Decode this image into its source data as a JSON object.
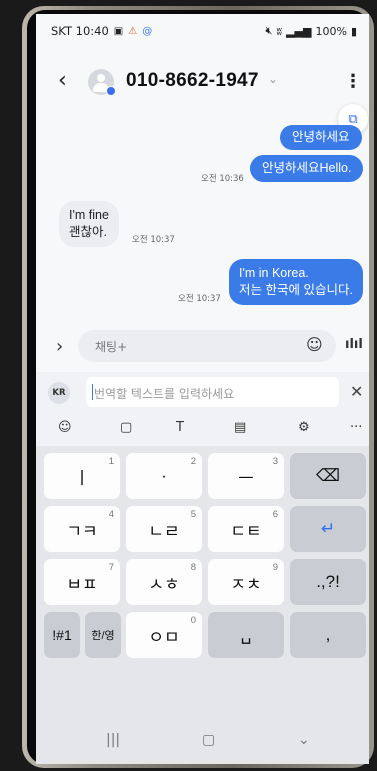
{
  "status_bar": {
    "carrier_time": "SKT 10:40",
    "battery": "100%"
  },
  "header": {
    "back": "‹",
    "contact": "010-8662-1947",
    "chevron": "⌄",
    "menu": "⋮"
  },
  "messages": [
    {
      "direction": "out",
      "text": "안녕하세요",
      "time": ""
    },
    {
      "direction": "out",
      "text": "안녕하세요Hello.",
      "time": "오전 10:36"
    },
    {
      "direction": "in",
      "lines": [
        "I'm fine",
        "괜찮아."
      ],
      "time": "오전 10:37"
    },
    {
      "direction": "out",
      "lines": [
        "I'm in Korea.",
        "저는 한국에 있습니다."
      ],
      "time": "오전 10:37"
    }
  ],
  "composer": {
    "placeholder": "채팅+",
    "expand_icon": "chevron-right-icon",
    "emoji_icon": "emoji-icon",
    "voice_icon": "voice-wave-icon"
  },
  "translate": {
    "lang": "KR",
    "placeholder": "번역할 텍스트를 입력하세요",
    "close": "✕"
  },
  "keyboard": {
    "rows": [
      [
        {
          "label": "ㅣ",
          "hint": "1"
        },
        {
          "label": "·",
          "hint": "2"
        },
        {
          "label": "ㅡ",
          "hint": "3"
        },
        {
          "label": "⌫",
          "func": true
        }
      ],
      [
        {
          "label": "ㄱㅋ",
          "hint": "4"
        },
        {
          "label": "ㄴㄹ",
          "hint": "5"
        },
        {
          "label": "ㄷㅌ",
          "hint": "6"
        },
        {
          "label": "↵",
          "func": true
        }
      ],
      [
        {
          "label": "ㅂㅍ",
          "hint": "7"
        },
        {
          "label": "ㅅㅎ",
          "hint": "8"
        },
        {
          "label": "ㅈㅊ",
          "hint": "9"
        },
        {
          "label": ".,?!",
          "func": true
        }
      ],
      [
        {
          "label": "!#1",
          "func": true
        },
        {
          "label": "한/영",
          "func": true
        },
        {
          "label": "ㅇㅁ",
          "hint": "0"
        },
        {
          "label": "␣",
          "func": true
        },
        {
          "label": ",",
          "func": true
        }
      ]
    ]
  },
  "colors": {
    "outgoing_bubble": "#3a7be8",
    "incoming_bubble": "#ebedf0",
    "accent": "#2f6fe8"
  }
}
